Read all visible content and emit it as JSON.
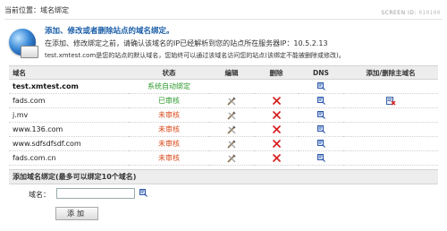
{
  "breadcrumb": "当前位置：域名绑定",
  "screen_id": {
    "label": "SCREEN ID:",
    "value": "010100"
  },
  "intro": {
    "title": "添加、修改或者删除站点的域名绑定。",
    "line1": "在添加、修改绑定之前，请确认该域名的IP已经解析到您的站点所在服务器IP：10.5.2.13",
    "line2": "test.xmtest.com是您的站点的默认域名，您始终可以通过该域名访问您的站点(该绑定不能被删除或修改)。"
  },
  "table": {
    "headers": {
      "domain": "域名",
      "status": "状态",
      "edit": "编辑",
      "delete": "删除",
      "dns": "DNS",
      "main": "添加/删除主域名"
    },
    "rows": [
      {
        "domain": "test.xmtest.com",
        "status": "系统自动绑定",
        "status_type": "system",
        "bold": true,
        "editable": false,
        "deletable": false,
        "dns": true,
        "main_action": false
      },
      {
        "domain": "fads.com",
        "status": "已审核",
        "status_type": "approved",
        "bold": false,
        "editable": true,
        "deletable": true,
        "dns": true,
        "main_action": true
      },
      {
        "domain": "j.mv",
        "status": "未审核",
        "status_type": "pending",
        "bold": false,
        "editable": true,
        "deletable": true,
        "dns": true,
        "main_action": false
      },
      {
        "domain": "www.136.com",
        "status": "未审核",
        "status_type": "pending",
        "bold": false,
        "editable": true,
        "deletable": true,
        "dns": true,
        "main_action": false
      },
      {
        "domain": "www.sdfsdfsdf.com",
        "status": "未审核",
        "status_type": "pending",
        "bold": false,
        "editable": true,
        "deletable": true,
        "dns": true,
        "main_action": false
      },
      {
        "domain": "fads.com.cn",
        "status": "未审核",
        "status_type": "pending",
        "bold": false,
        "editable": true,
        "deletable": true,
        "dns": true,
        "main_action": false
      }
    ]
  },
  "bind": {
    "title": "添加域名绑定(最多可以绑定10个域名)",
    "label": "域名：",
    "value": "",
    "placeholder": "",
    "button": "添加"
  },
  "icons": {
    "globe": "globe-icon",
    "edit": "tools-edit-icon",
    "delete": "red-x-icon",
    "dns": "dns-lookup-icon",
    "remove_main": "remove-main-domain-icon"
  },
  "colors": {
    "title_blue": "#1a5ea8",
    "status_green": "#2f9a2f",
    "status_red": "#d84a1a",
    "header_gray": "#ededed"
  }
}
